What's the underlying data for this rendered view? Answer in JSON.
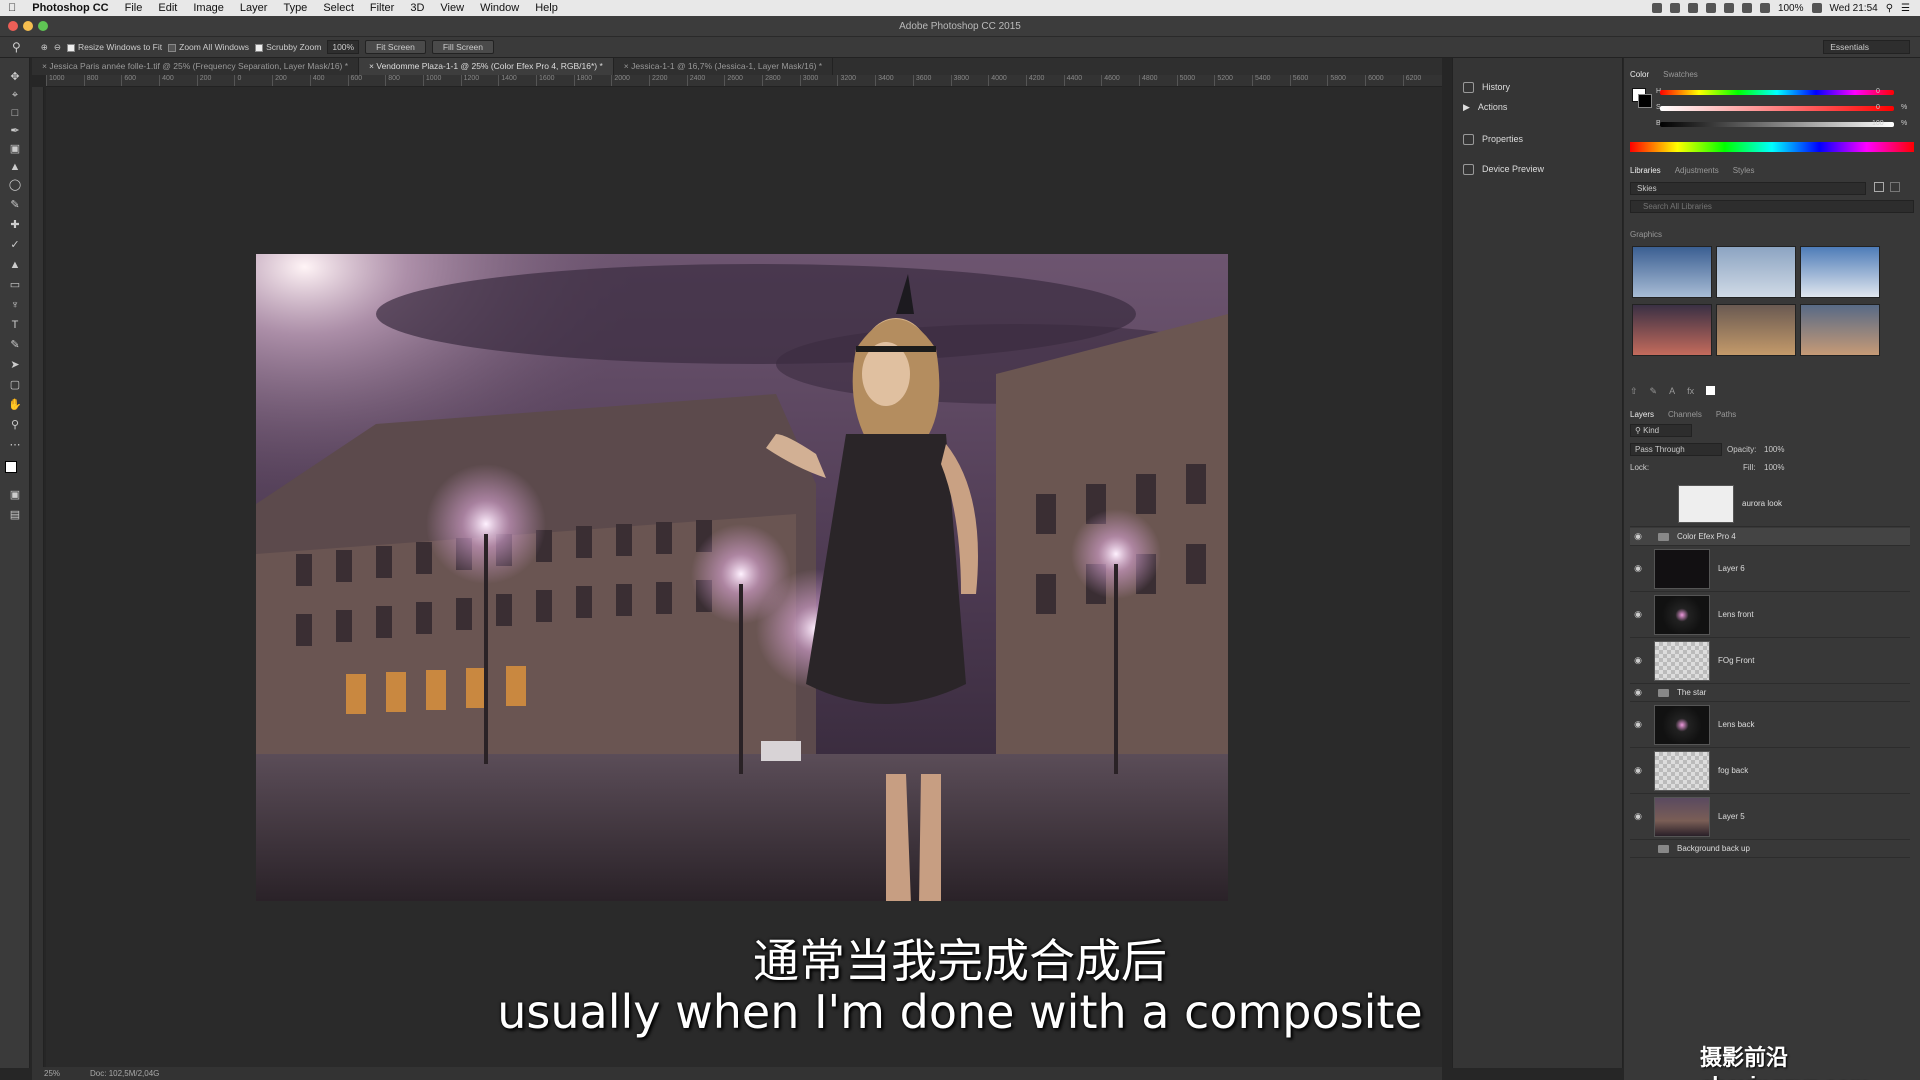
{
  "menubar": {
    "apple": "",
    "app_name": "Photoshop CC",
    "menus": [
      "File",
      "Edit",
      "Image",
      "Layer",
      "Type",
      "Select",
      "Filter",
      "3D",
      "View",
      "Window",
      "Help"
    ],
    "battery": "100%",
    "clock": "Wed 21:54"
  },
  "window": {
    "title": "Adobe Photoshop CC 2015"
  },
  "options": {
    "resize_windows": "Resize Windows to Fit",
    "zoom_all": "Zoom All Windows",
    "scrubby": "Scrubby Zoom",
    "zoom_value": "100%",
    "fit_screen": "Fit Screen",
    "fill_screen": "Fill Screen",
    "workspace": "Essentials"
  },
  "doc_tabs": [
    "Jessica Paris année folle-1.tif @ 25% (Frequency Separation, Layer Mask/16) *",
    "Vendomme Plaza-1-1 @ 25% (Color Efex Pro 4, RGB/16*) *",
    "Jessica-1-1 @ 16,7% (Jessica-1, Layer Mask/16) *"
  ],
  "ruler_ticks": [
    "1000",
    "800",
    "600",
    "400",
    "200",
    "0",
    "200",
    "400",
    "600",
    "800",
    "1000",
    "1200",
    "1400",
    "1600",
    "1800",
    "2000",
    "2200",
    "2400",
    "2600",
    "2800",
    "3000",
    "3200",
    "3400",
    "3600",
    "3800",
    "4000",
    "4200",
    "4400",
    "4600",
    "4800",
    "5000",
    "5200",
    "5400",
    "5600",
    "5800",
    "6000",
    "6200"
  ],
  "status": {
    "zoom": "25%",
    "doc": "Doc: 102,5M/2,04G"
  },
  "subtitles": {
    "cn": "通常当我完成合成后",
    "en": "usually when I'm done with a composite"
  },
  "watermark": "摄影前沿 sheyingzyz.com",
  "dock": {
    "history": "History",
    "actions": "Actions",
    "properties": "Properties",
    "device_preview": "Device Preview"
  },
  "color_panel": {
    "tabs": [
      "Color",
      "Swatches"
    ],
    "h_label": "H",
    "s_label": "S",
    "b_label": "B",
    "h_value": "0",
    "s_value": "0",
    "b_value": "100",
    "pct": "%"
  },
  "libraries": {
    "tabs": [
      "Libraries",
      "Adjustments",
      "Styles"
    ],
    "library_name": "Skies",
    "search_placeholder": "Search All Libraries",
    "graphics_label": "Graphics"
  },
  "layers": {
    "tabs": [
      "Layers",
      "Channels",
      "Paths"
    ],
    "kind": "Kind",
    "blend_mode": "Pass Through",
    "opacity_label": "Opacity:",
    "opacity_value": "100%",
    "lock_label": "Lock:",
    "fill_label": "Fill:",
    "fill_value": "100%",
    "items": [
      {
        "name": "aurora look",
        "type": "mask"
      },
      {
        "name": "Color Efex Pro 4",
        "type": "group"
      },
      {
        "name": "Layer 6",
        "type": "dark"
      },
      {
        "name": "Lens front",
        "type": "flare"
      },
      {
        "name": "FOg Front",
        "type": "checker"
      },
      {
        "name": "The star",
        "type": "group"
      },
      {
        "name": "Lens back",
        "type": "flare"
      },
      {
        "name": "fog back",
        "type": "checker"
      },
      {
        "name": "Layer 5",
        "type": "photo"
      },
      {
        "name": "Background back up",
        "type": "group"
      }
    ]
  },
  "colors": {
    "accent": "#4a90d9",
    "panel": "#383838",
    "canvas": "#2a2a2a"
  }
}
